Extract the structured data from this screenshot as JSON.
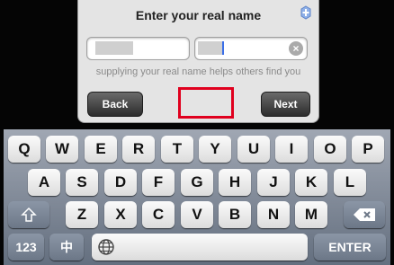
{
  "dialog": {
    "title": "Enter your real name",
    "hint": "supplying your real name helps others find you",
    "back_label": "Back",
    "next_label": "Next"
  },
  "keyboard": {
    "row1": [
      "Q",
      "W",
      "E",
      "R",
      "T",
      "Y",
      "U",
      "I",
      "O",
      "P"
    ],
    "row2": [
      "A",
      "S",
      "D",
      "F",
      "G",
      "H",
      "J",
      "K",
      "L"
    ],
    "row3": [
      "Z",
      "X",
      "C",
      "V",
      "B",
      "N",
      "M"
    ],
    "numbers_label": "123",
    "chinese_label": "中",
    "enter_label": "ENTER",
    "shift_icon": "shift-icon",
    "backspace_icon": "backspace-icon",
    "globe_icon": "globe-icon"
  },
  "colors": {
    "highlight": "#e0001e",
    "cursor": "#3a6ee8",
    "keyboard_bg": "#8a95a5"
  }
}
